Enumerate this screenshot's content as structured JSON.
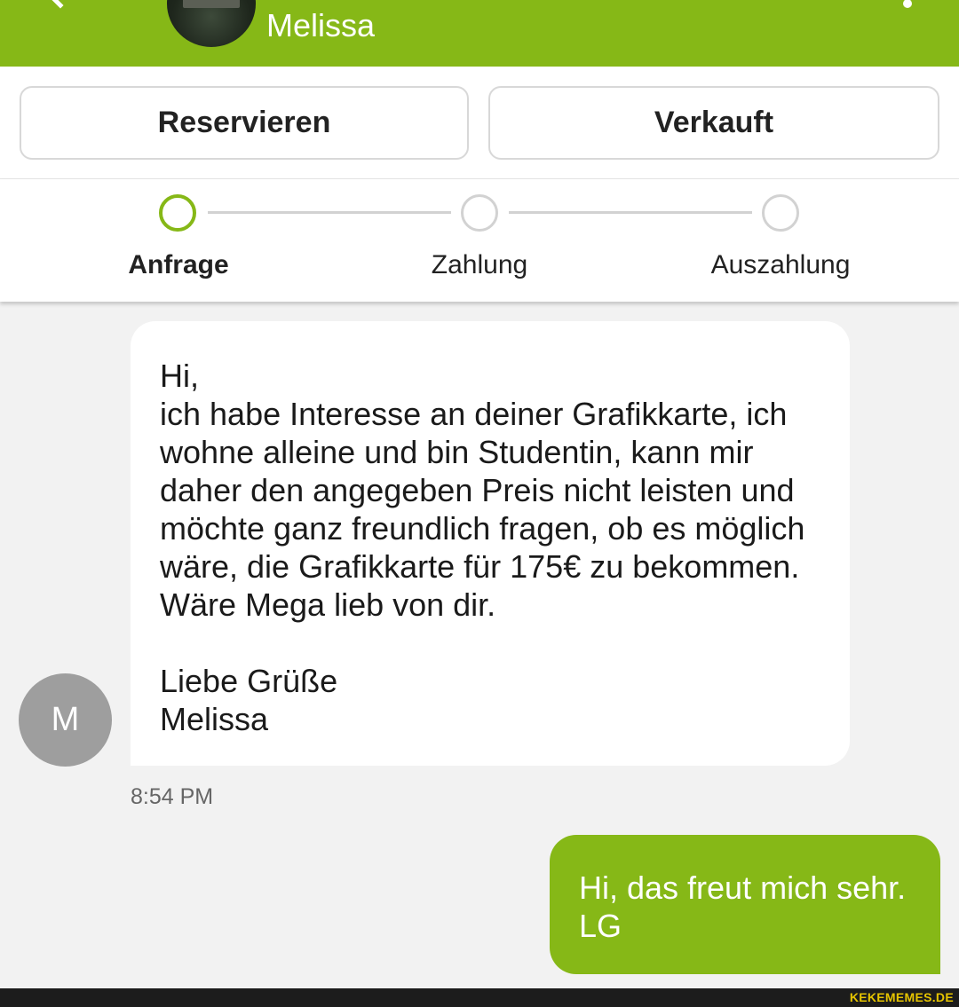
{
  "header": {
    "contact_name": "Melissa",
    "back_icon": "back-arrow-icon",
    "menu_icon": "more-vertical-icon"
  },
  "actions": {
    "reserve_label": "Reservieren",
    "sold_label": "Verkauft"
  },
  "progress": {
    "steps": [
      {
        "label": "Anfrage",
        "active": true
      },
      {
        "label": "Zahlung",
        "active": false
      },
      {
        "label": "Auszahlung",
        "active": false
      }
    ]
  },
  "messages": [
    {
      "direction": "incoming",
      "avatar_initial": "M",
      "text": "Hi,\nich habe Interesse an deiner Grafikkarte, ich\nwohne alleine und bin Studentin, kann mir\ndaher den angegeben Preis nicht leisten und\nmöchte ganz freundlich fragen, ob es möglich\nwäre, die Grafikkarte für 175€ zu bekommen.\nWäre Mega lieb von dir.\n\nLiebe Grüße\nMelissa",
      "time": "8:54 PM"
    },
    {
      "direction": "outgoing",
      "text": "Hi, das freut mich sehr.\nLG"
    }
  ],
  "watermark": "KEKEMEMES.DE",
  "colors": {
    "accent": "#86b817",
    "avatar_gray": "#9e9e9e",
    "background": "#f2f2f2"
  }
}
